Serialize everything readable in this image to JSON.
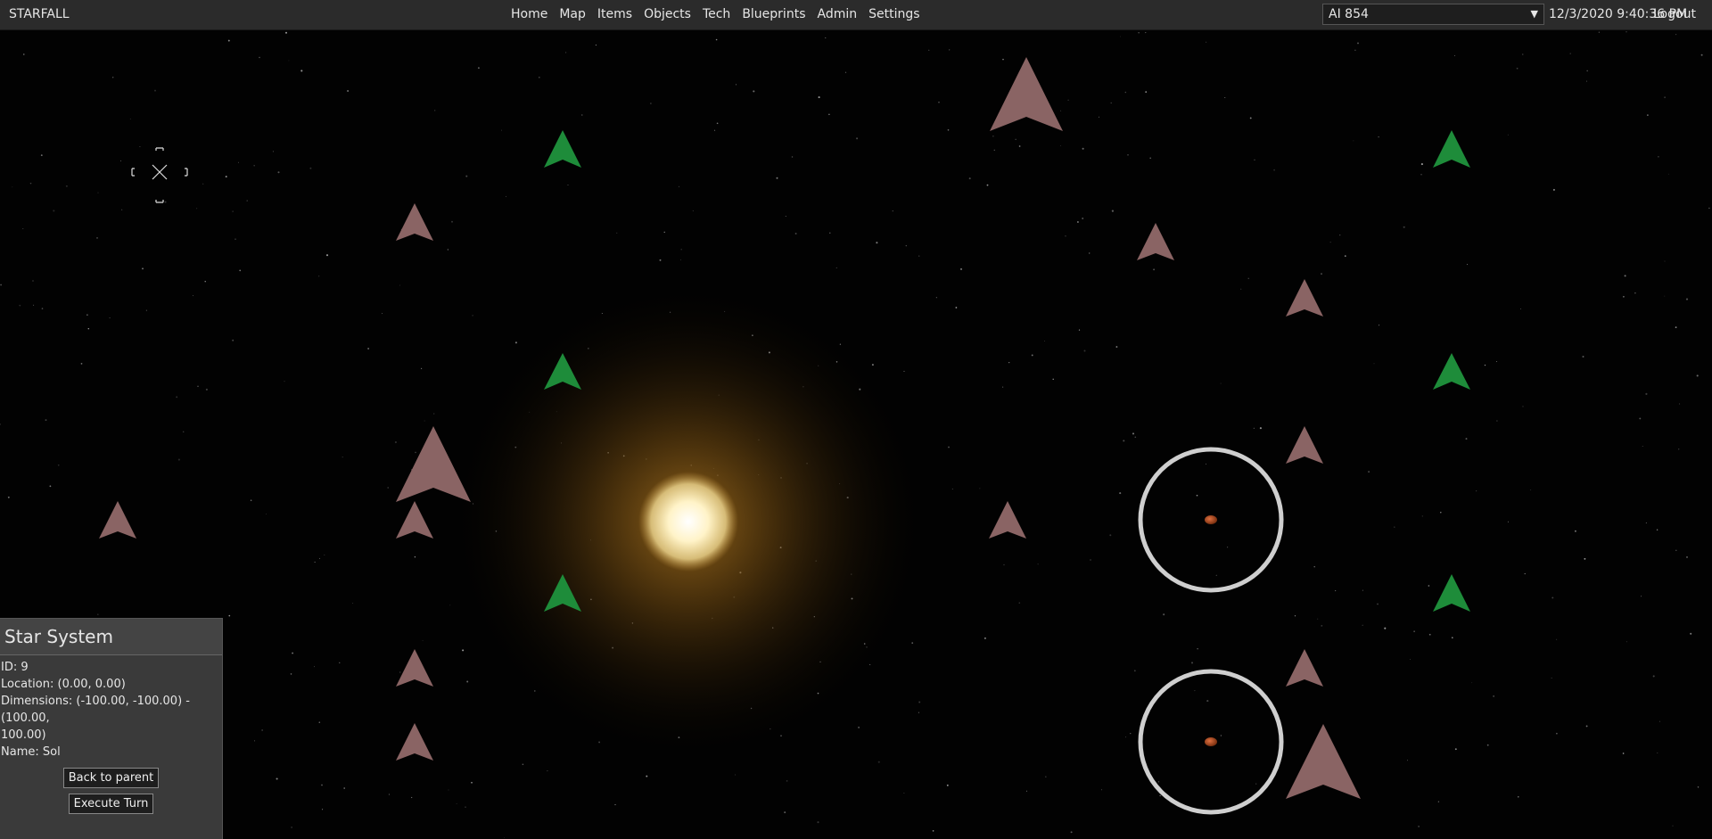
{
  "header": {
    "brand": "STARFALL",
    "nav": [
      "Home",
      "Map",
      "Items",
      "Objects",
      "Tech",
      "Blueprints",
      "Admin",
      "Settings"
    ],
    "player_select": "AI 854",
    "datetime": "12/3/2020 9:40:36 PM",
    "logout": "Logout"
  },
  "panel": {
    "title": "Star System",
    "id": "ID: 9",
    "location": "Location: (0.00, 0.00)",
    "dimensions_line1": "Dimensions: (-100.00, -100.00) - (100.00,",
    "dimensions_line2": "100.00)",
    "name": "Name: Sol",
    "back_button": "Back to parent",
    "execute_button": "Execute Turn"
  },
  "colors": {
    "topbar": "#2b2b2b",
    "panel": "#3a3a3a",
    "friendly_ship": "#1e8c3a",
    "neutral_ship": "#8a6464",
    "star_core": "#fff6d8",
    "star_glow": "#8a5a10",
    "planet_ring": "#cfcfcf"
  },
  "map": {
    "icons": [
      "crosshair-icon",
      "star-icon",
      "friendly-ship-icon",
      "neutral-ship-icon",
      "planet-icon"
    ]
  }
}
